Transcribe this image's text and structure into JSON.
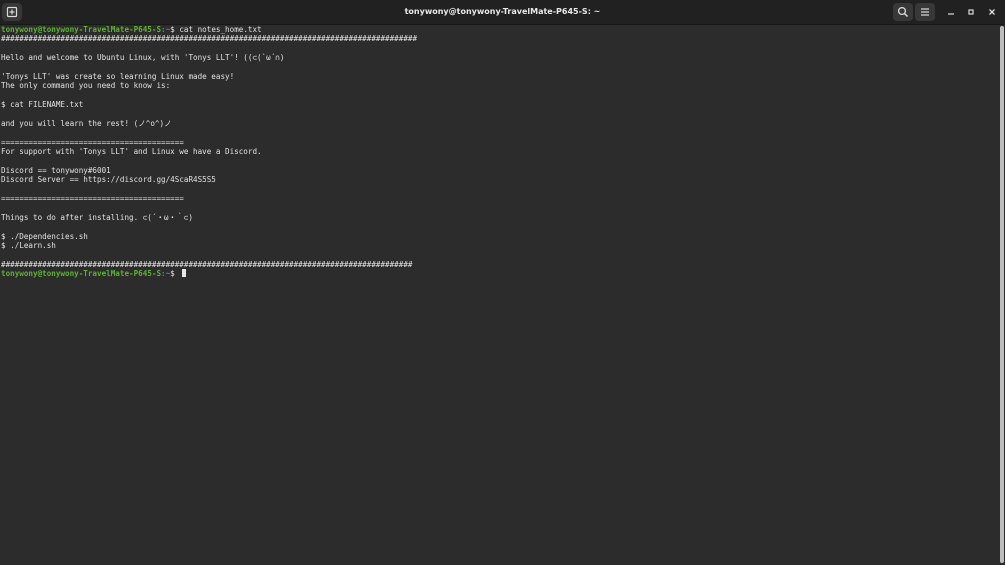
{
  "window": {
    "title": "tonywony@tonywony-TravelMate-P645-S: ~"
  },
  "terminal": {
    "prompt_user": "tonywony@tonywony-TravelMate-P645-S",
    "prompt_path": ":~",
    "prompt_symbol": "$ ",
    "command": "cat notes_home.txt",
    "output": [
      "###########################################################################################",
      "",
      "Hello and welcome to Ubuntu Linux, with 'Tonys LLT'! ((⊂(`ω´∩)",
      "",
      "'Tonys LLT' was create so learning Linux made easy!",
      "The only command you need to know is:",
      "",
      "$ cat FILENAME.txt",
      "",
      "and you will learn the rest! (ノ^o^)ノ",
      "",
      "========================================",
      "For support with 'Tonys LLT' and Linux we have a Discord.",
      "",
      "Discord == tonywony#6001",
      "Discord Server == https://discord.gg/4ScaR4S5S5",
      "",
      "========================================",
      "",
      "Things to do after installing. ⊂(´・ω・｀⊂)",
      "",
      "$ ./Dependencies.sh",
      "$ ./Learn.sh",
      "",
      "##########################################################################################"
    ]
  }
}
